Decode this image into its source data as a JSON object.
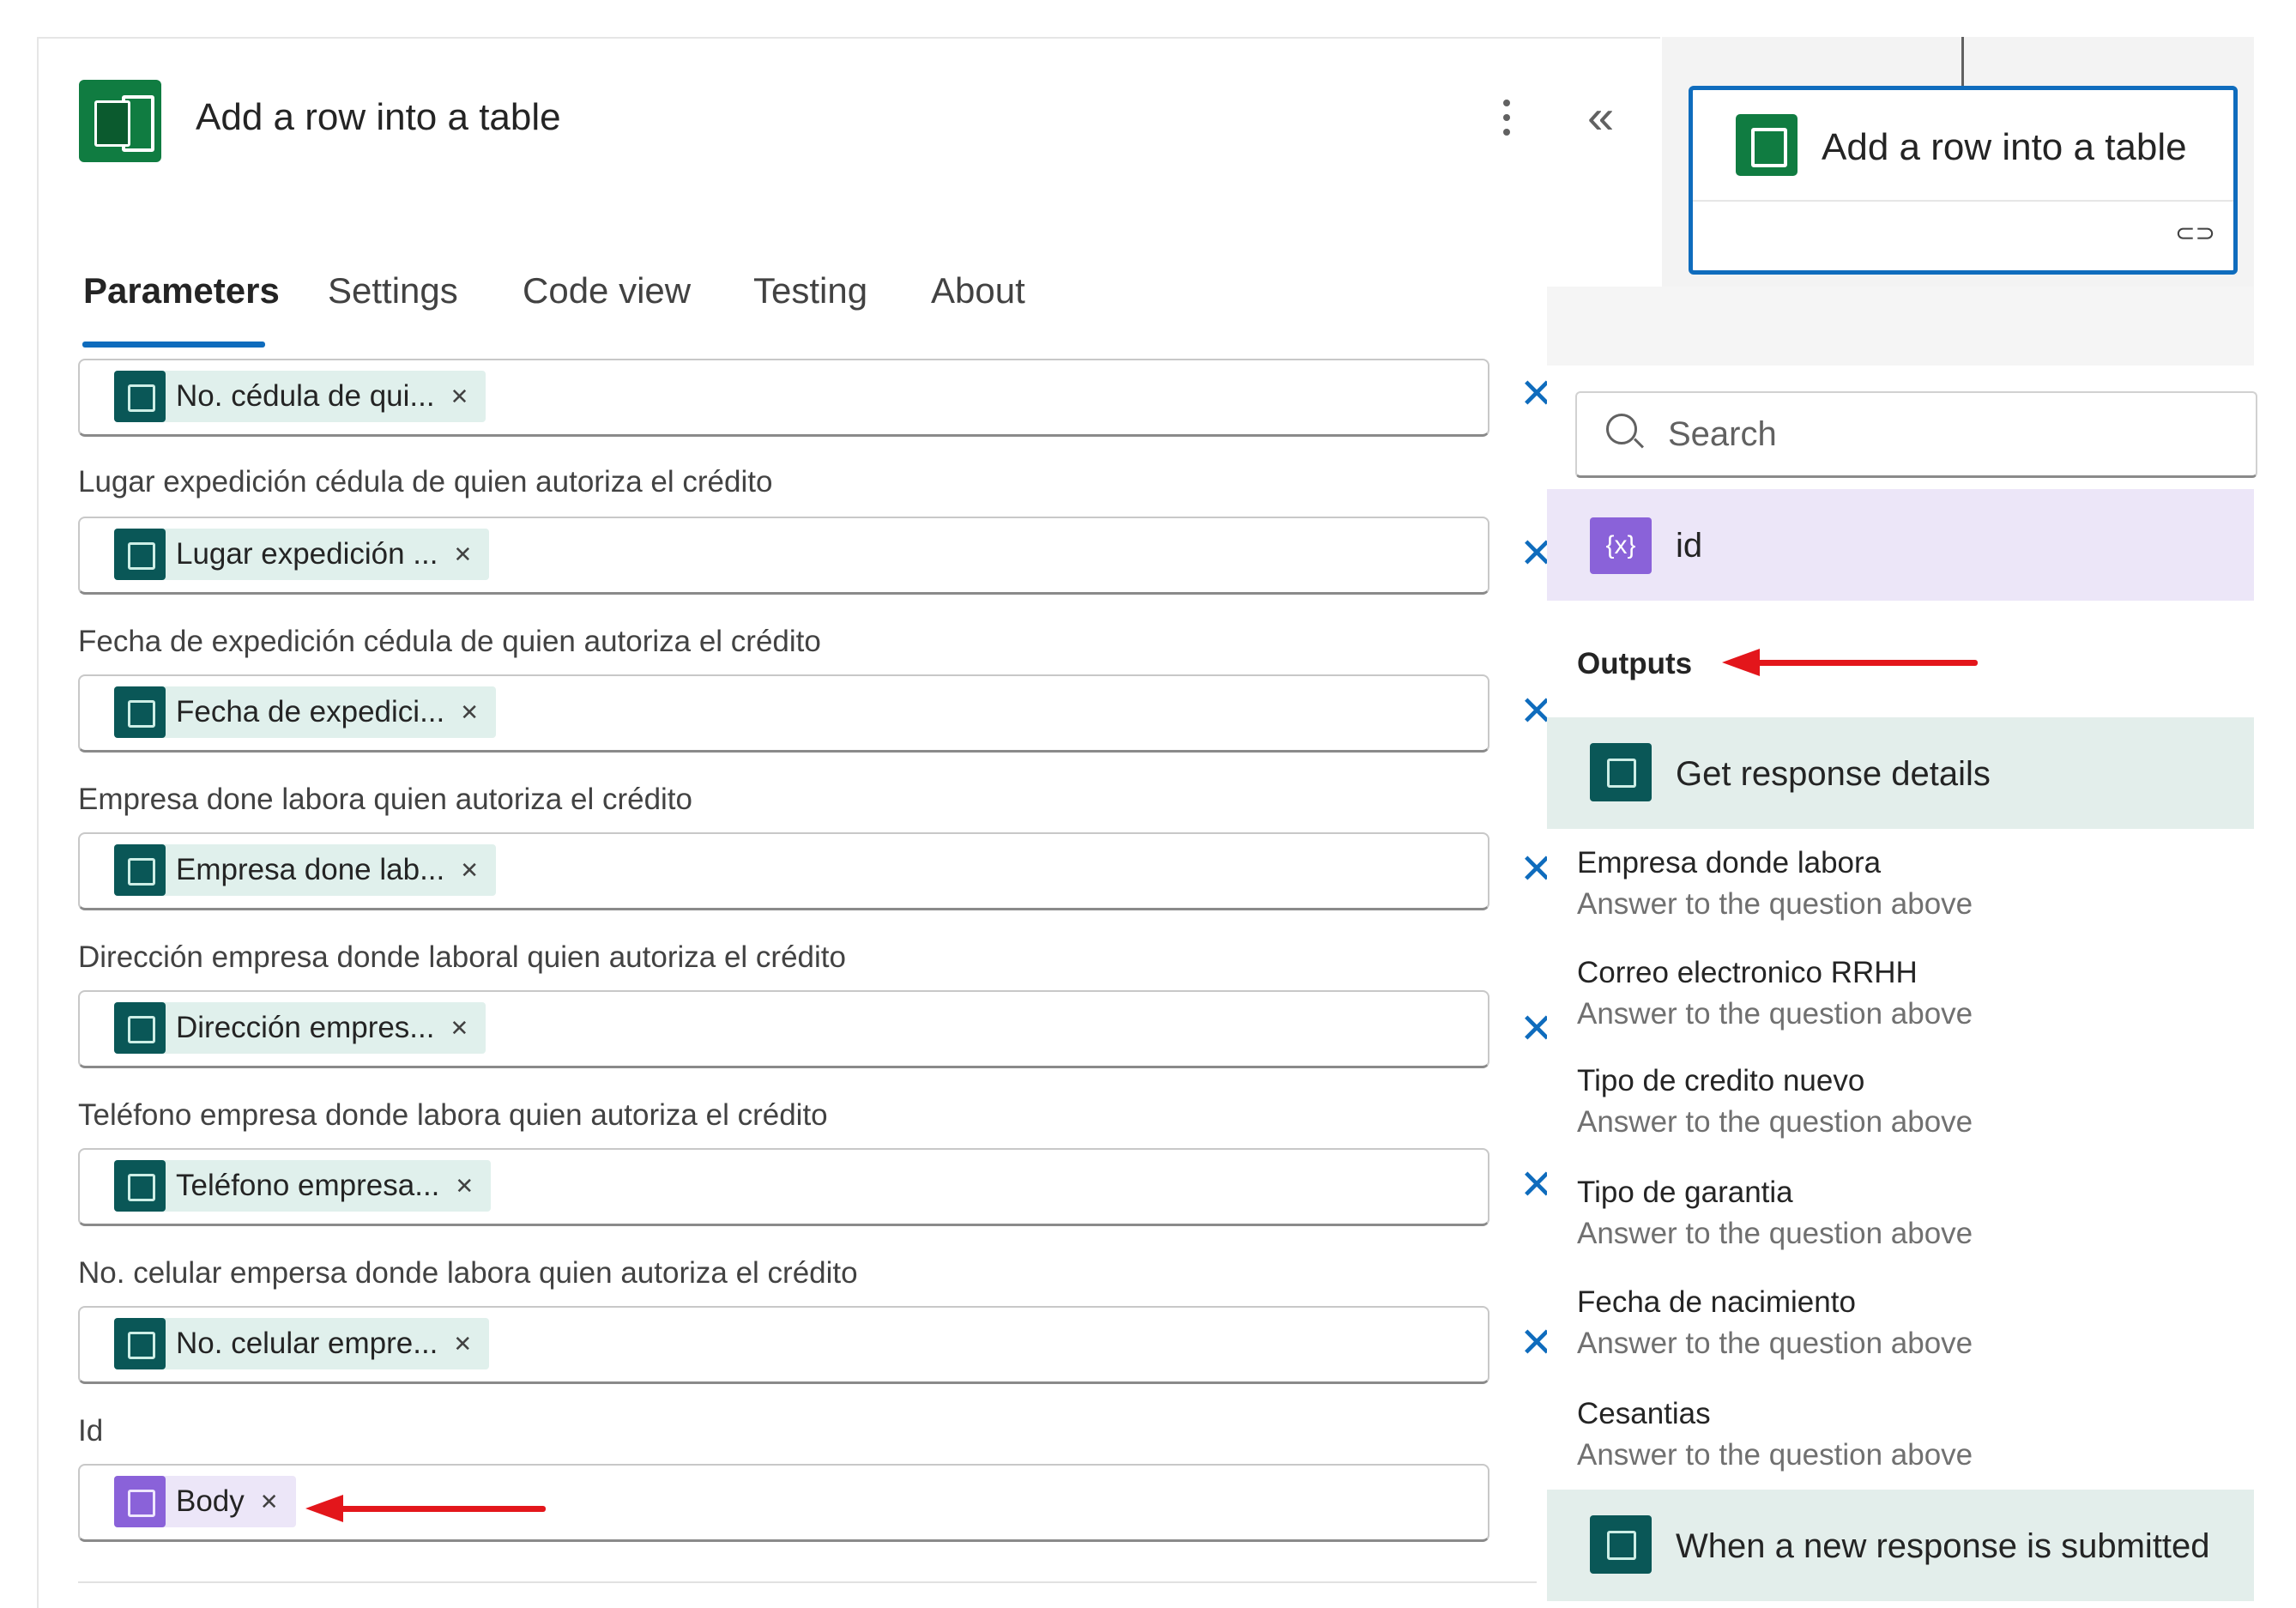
{
  "header": {
    "title": "Add a row into a table"
  },
  "tabs": [
    {
      "label": "Parameters",
      "active": true
    },
    {
      "label": "Settings"
    },
    {
      "label": "Code view"
    },
    {
      "label": "Testing"
    },
    {
      "label": "About"
    }
  ],
  "fields": [
    {
      "label": "",
      "token": "No. cédula de qui...",
      "color": "teal"
    },
    {
      "label": "Lugar expedición cédula de quien autoriza el crédito",
      "token": "Lugar expedición ...",
      "color": "teal"
    },
    {
      "label": "Fecha de expedición cédula de quien autoriza el crédito",
      "token": "Fecha de expedici...",
      "color": "teal"
    },
    {
      "label": "Empresa done labora quien autoriza el crédito",
      "token": "Empresa done lab...",
      "color": "teal"
    },
    {
      "label": "Dirección empresa donde laboral quien autoriza el crédito",
      "token": "Dirección empres...",
      "color": "teal"
    },
    {
      "label": "Teléfono empresa donde labora quien autoriza el crédito",
      "token": "Teléfono empresa...",
      "color": "teal"
    },
    {
      "label": "No. celular empersa donde labora quien autoriza el crédito",
      "token": "No. celular empre...",
      "color": "teal"
    },
    {
      "label": "Id",
      "token": "Body",
      "color": "purple"
    }
  ],
  "card": {
    "title": "Add a row into a table",
    "link_glyph": "⊂⊃"
  },
  "dropdown": {
    "search_placeholder": "Search",
    "id_item": "id",
    "outputs_label": "Outputs",
    "section1": "Get response details",
    "items": [
      {
        "name": "Empresa donde labora",
        "desc": "Answer to the question above"
      },
      {
        "name": "Correo electronico RRHH",
        "desc": "Answer to the question above"
      },
      {
        "name": "Tipo de credito nuevo",
        "desc": "Answer to the question above"
      },
      {
        "name": "Tipo de garantia",
        "desc": "Answer to the question above"
      },
      {
        "name": "Fecha de nacimiento",
        "desc": "Answer to the question above"
      },
      {
        "name": "Cesantias",
        "desc": "Answer to the question above"
      }
    ],
    "section2": "When a new response is submitted"
  },
  "colors": {
    "accent": "#0f6cbd",
    "excel": "#107c41",
    "forms": "#0a5757",
    "variable": "#8a62d9",
    "arrow": "#e3161b"
  }
}
